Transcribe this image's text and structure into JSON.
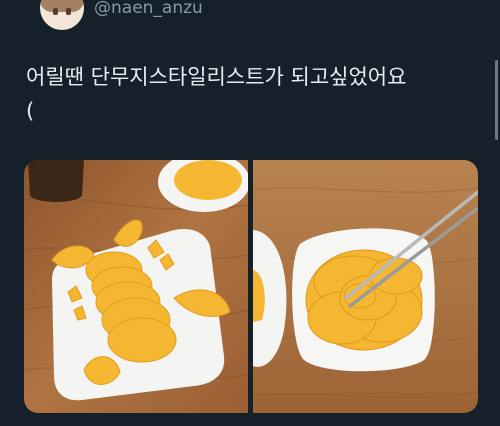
{
  "tweet": {
    "handle": "@naen_anzu",
    "text": "어릴땐 단무지스타일리스트가 되고싶었어요\n("
  },
  "media": {
    "images": [
      {
        "name": "plate-arranged-danmuji"
      },
      {
        "name": "bowl-rose-danmuji-chopsticks"
      }
    ]
  },
  "colors": {
    "background": "#15202b",
    "handle": "#8899a6",
    "text": "#e8edf2",
    "danmuji": "#f5b731",
    "wood": "#a5683a"
  }
}
